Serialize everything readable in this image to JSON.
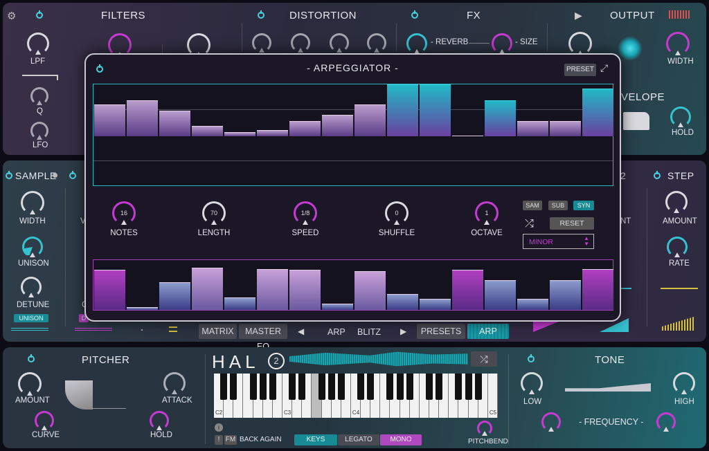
{
  "colors": {
    "accent_pink": "#c53bd1",
    "accent_teal": "#35c2d0",
    "panel_bg": "#2b2a3d",
    "dialog_bg": "#1b1727"
  },
  "top": {
    "filters": {
      "title": "FILTERS",
      "lpf": "LPF",
      "q": "Q",
      "lfo": "LFO"
    },
    "distortion": {
      "title": "DISTORTION"
    },
    "fx": {
      "title": "FX",
      "reverb": "- REVERB",
      "size": "- SIZE"
    },
    "output": {
      "title": "OUTPUT",
      "width": "WIDTH",
      "envelope_partial": "VELOPE",
      "hold": "HOLD"
    }
  },
  "mid": {
    "sample": {
      "title": "SAMPLE",
      "width": "WIDTH",
      "unison": "UNISON",
      "detune": "DETUNE",
      "unison_btn": "UNISON"
    },
    "step": {
      "title": "STEP",
      "amount": "AMOUNT",
      "rate": "RATE"
    },
    "partial": {
      "v": "V",
      "d": "D",
      "c": "C",
      "nt": "NT",
      "two": "2"
    }
  },
  "arp": {
    "title": "- ARPEGGIATOR -",
    "preset_btn": "PRESET",
    "top_steps": [
      0.62,
      0.7,
      0.5,
      0.2,
      0.08,
      0.12,
      0.3,
      0.42,
      0.62,
      1.0,
      1.0,
      0.0,
      0.7,
      0.3,
      0.3,
      0.92
    ],
    "top_highlight": [
      false,
      false,
      false,
      false,
      false,
      false,
      false,
      false,
      false,
      true,
      true,
      false,
      true,
      false,
      false,
      true
    ],
    "bottom_steps": [
      0.8,
      0.05,
      0.55,
      0.85,
      0.25,
      0.82,
      0.8,
      0.13,
      0.78,
      0.32,
      0.22,
      0.8,
      0.6,
      0.22,
      0.6,
      0.82
    ],
    "knobs": [
      {
        "label": "NOTES",
        "value": "16"
      },
      {
        "label": "LENGTH",
        "value": "70"
      },
      {
        "label": "SPEED",
        "value": "1/8"
      },
      {
        "label": "SHUFFLE",
        "value": "0"
      },
      {
        "label": "OCTAVE",
        "value": "1"
      }
    ],
    "modes": {
      "sam": "SAM",
      "sub": "SUB",
      "syn": "SYN"
    },
    "reset": "RESET",
    "scale": "MINOR"
  },
  "toolbar": {
    "matrix": "MATRIX",
    "master_eq": "MASTER EQ",
    "arp_label": "ARP",
    "preset_name": "BLITZ",
    "presets": "PRESETS",
    "arp_btn": "ARP"
  },
  "bottom": {
    "pitcher": {
      "title": "PITCHER",
      "amount": "AMOUNT",
      "attack": "ATTACK",
      "curve": "CURVE",
      "hold": "HOLD"
    },
    "logo": "HAL",
    "logo_num": "2",
    "keyboard": {
      "c2": "C2",
      "c3": "C3",
      "c4": "C4",
      "c5": "C5"
    },
    "fm": "FM",
    "excl": "!",
    "patch": "BACK AGAIN",
    "keys": "KEYS",
    "legato": "LEGATO",
    "mono": "MONO",
    "pitchbend": "PITCHBEND",
    "tone": {
      "title": "TONE",
      "low": "LOW",
      "high": "HIGH",
      "frequency": "- FREQUENCY -"
    }
  }
}
